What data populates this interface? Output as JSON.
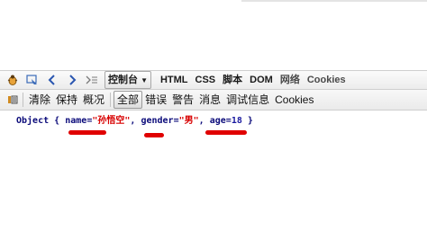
{
  "toolbar": {
    "console_menu_label": "控制台",
    "tabs": [
      "HTML",
      "CSS",
      "脚本",
      "DOM",
      "网络",
      "Cookies"
    ]
  },
  "filterbar": {
    "clear_label": "清除",
    "persist_label": "保持",
    "profile_label": "概况",
    "filters": [
      "全部",
      "错误",
      "警告",
      "消息",
      "调试信息",
      "Cookies"
    ]
  },
  "console": {
    "object_prefix": "Object",
    "open_brace": "{",
    "close_brace": "}",
    "name_key": "name",
    "name_value": "\"孙悟空\"",
    "gender_key": "gender",
    "gender_value": "\"男\"",
    "age_key": "age",
    "age_value": "18",
    "eq": "=",
    "comma": ","
  },
  "colors": {
    "annotation": "#e00000",
    "string": "#d80000",
    "key": "#0b0b7a"
  },
  "icons": [
    "firebug-bug-icon",
    "inspect-cursor-icon",
    "back-arrow-icon",
    "forward-arrow-icon",
    "command-line-icon",
    "dropdown-arrow-icon",
    "console-filter-icon"
  ]
}
